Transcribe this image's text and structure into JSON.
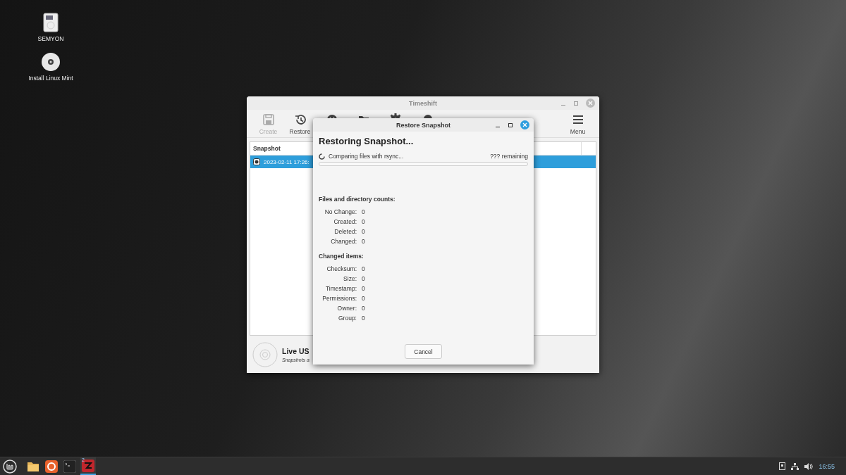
{
  "desktop_icons": [
    {
      "label": "SEMYON",
      "kind": "drive"
    },
    {
      "label": "Install Linux Mint",
      "kind": "disc"
    }
  ],
  "main_window": {
    "title": "Timeshift",
    "toolbar": [
      {
        "label": "Create",
        "kind": "save",
        "disabled": true
      },
      {
        "label": "Restore",
        "kind": "history",
        "disabled": false
      },
      {
        "kind": "delete"
      },
      {
        "kind": "folder"
      },
      {
        "kind": "settings"
      },
      {
        "kind": "wizard"
      }
    ],
    "menu_button": {
      "label": "Menu"
    },
    "table": {
      "columns": [
        "Snapshot"
      ],
      "rows": [
        {
          "cells": [
            "2023-02-11 17:26:"
          ],
          "selected": true
        }
      ]
    },
    "status": {
      "title": "Live US",
      "subtitle": "Snapshots a"
    }
  },
  "dialog": {
    "title": "Restore Snapshot",
    "heading": "Restoring Snapshot...",
    "status": "Comparing files with rsync...",
    "remaining": "??? remaining",
    "progress": {
      "level": 0
    },
    "sections": [
      {
        "title": "Files and directory counts:",
        "rows": [
          {
            "label": "No Change:",
            "value": "0"
          },
          {
            "label": "Created:",
            "value": "0"
          },
          {
            "label": "Deleted:",
            "value": "0"
          },
          {
            "label": "Changed:",
            "value": "0"
          }
        ]
      },
      {
        "title": "Changed items:",
        "rows": [
          {
            "label": "Checksum:",
            "value": "0"
          },
          {
            "label": "Size:",
            "value": "0"
          },
          {
            "label": "Timestamp:",
            "value": "0"
          },
          {
            "label": "Permissions:",
            "value": "0"
          },
          {
            "label": "Owner:",
            "value": "0"
          },
          {
            "label": "Group:",
            "value": "0"
          }
        ]
      }
    ],
    "buttons": [
      "Cancel"
    ]
  },
  "taskbar": {
    "apps": [
      {
        "kind": "files",
        "active": false
      },
      {
        "kind": "browser",
        "active": false
      },
      {
        "kind": "terminal",
        "active": false
      },
      {
        "kind": "timeshift",
        "badge": "2",
        "active": true
      }
    ],
    "clock": "16:55"
  }
}
